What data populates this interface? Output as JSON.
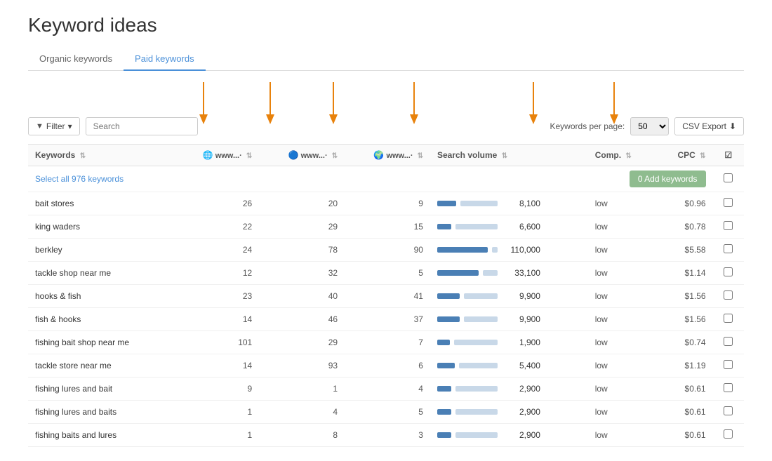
{
  "page": {
    "title": "Keyword ideas",
    "tabs": [
      {
        "label": "Organic keywords",
        "active": false
      },
      {
        "label": "Paid keywords",
        "active": true
      }
    ]
  },
  "toolbar": {
    "filter_label": "Filter",
    "search_placeholder": "Search",
    "kpp_label": "Keywords per page:",
    "kpp_value": "50",
    "csv_label": "CSV Export"
  },
  "table": {
    "select_all_label": "Select all 976 keywords",
    "add_keywords_label": "0 Add keywords",
    "columns": [
      "Keywords",
      "www...·",
      "www...·",
      "www...·",
      "Search volume",
      "Comp.",
      "CPC",
      ""
    ],
    "rows": [
      {
        "keyword": "bait stores",
        "c1": 26,
        "c2": 20,
        "c3": 9,
        "vol": 8100,
        "vol_pct": 30,
        "comp": "low",
        "cpc": "$0.96"
      },
      {
        "keyword": "king waders",
        "c1": 22,
        "c2": 29,
        "c3": 15,
        "vol": 6600,
        "vol_pct": 22,
        "comp": "low",
        "cpc": "$0.78"
      },
      {
        "keyword": "berkley",
        "c1": 24,
        "c2": 78,
        "c3": 90,
        "vol": 110000,
        "vol_pct": 80,
        "comp": "low",
        "cpc": "$5.58"
      },
      {
        "keyword": "tackle shop near me",
        "c1": 12,
        "c2": 32,
        "c3": 5,
        "vol": 33100,
        "vol_pct": 65,
        "comp": "low",
        "cpc": "$1.14"
      },
      {
        "keyword": "hooks & fish",
        "c1": 23,
        "c2": 40,
        "c3": 41,
        "vol": 9900,
        "vol_pct": 35,
        "comp": "low",
        "cpc": "$1.56"
      },
      {
        "keyword": "fish & hooks",
        "c1": 14,
        "c2": 46,
        "c3": 37,
        "vol": 9900,
        "vol_pct": 35,
        "comp": "low",
        "cpc": "$1.56"
      },
      {
        "keyword": "fishing bait shop near me",
        "c1": 101,
        "c2": 29,
        "c3": 7,
        "vol": 1900,
        "vol_pct": 20,
        "comp": "low",
        "cpc": "$0.74"
      },
      {
        "keyword": "tackle store near me",
        "c1": 14,
        "c2": 93,
        "c3": 6,
        "vol": 5400,
        "vol_pct": 28,
        "comp": "low",
        "cpc": "$1.19"
      },
      {
        "keyword": "fishing lures and bait",
        "c1": 9,
        "c2": 1,
        "c3": 4,
        "vol": 2900,
        "vol_pct": 22,
        "comp": "low",
        "cpc": "$0.61"
      },
      {
        "keyword": "fishing lures and baits",
        "c1": 1,
        "c2": 4,
        "c3": 5,
        "vol": 2900,
        "vol_pct": 22,
        "comp": "low",
        "cpc": "$0.61"
      },
      {
        "keyword": "fishing baits and lures",
        "c1": 1,
        "c2": 8,
        "c3": 3,
        "vol": 2900,
        "vol_pct": 22,
        "comp": "low",
        "cpc": "$0.61"
      }
    ]
  },
  "arrows": {
    "count": 6,
    "color": "#e8820c"
  }
}
